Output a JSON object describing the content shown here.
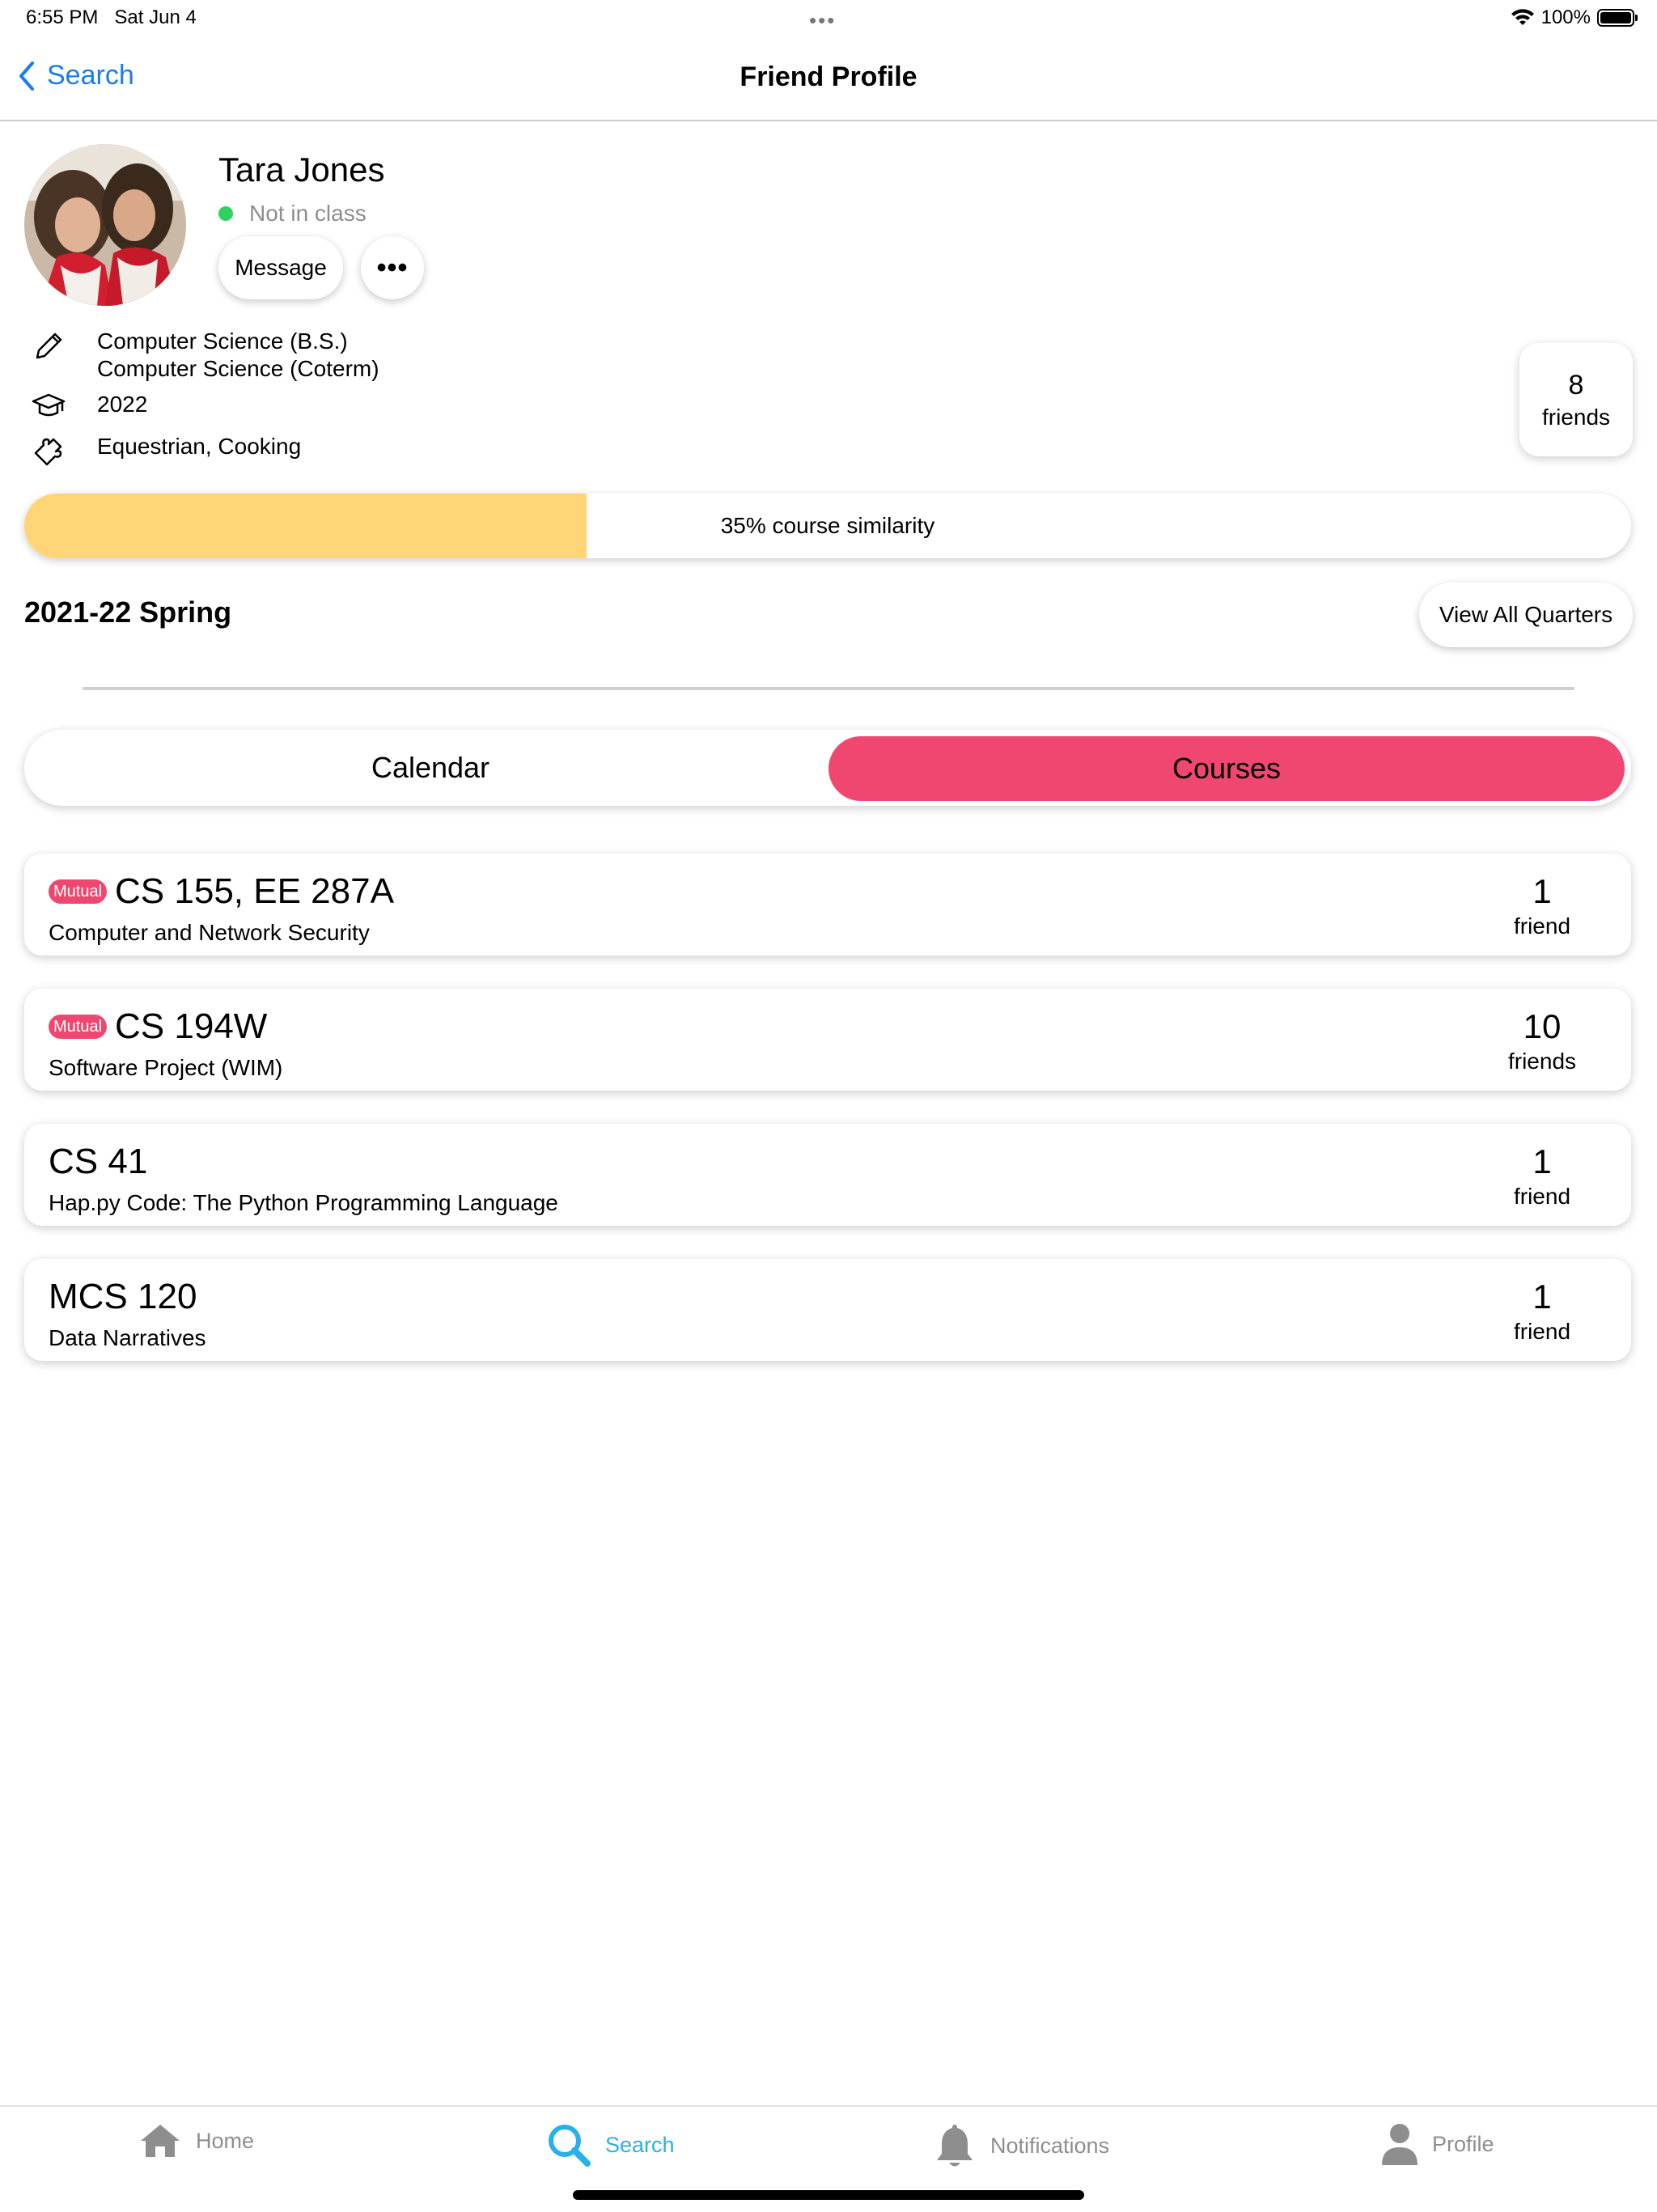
{
  "status_bar": {
    "time": "6:55 PM",
    "date": "Sat Jun 4",
    "dots": "•••",
    "battery": "100%"
  },
  "nav": {
    "back_label": "Search",
    "title": "Friend Profile"
  },
  "profile": {
    "name": "Tara Jones",
    "status": "Not in class",
    "message_label": "Message",
    "more_label": "•••",
    "majors": [
      "Computer Science (B.S.)",
      "Computer Science (Coterm)"
    ],
    "year": "2022",
    "interests": "Equestrian, Cooking",
    "friends_count": "8",
    "friends_label": "friends"
  },
  "similarity": {
    "percent": 35,
    "label": "35% course similarity"
  },
  "quarter": {
    "label": "2021-22 Spring",
    "view_all_label": "View All Quarters"
  },
  "segments": {
    "calendar": "Calendar",
    "courses": "Courses",
    "selected": "courses"
  },
  "courses": [
    {
      "mutual": "Mutual",
      "code": "CS 155, EE 287A",
      "title": "Computer and Network Security",
      "count": "1",
      "count_label": "friend"
    },
    {
      "mutual": "Mutual",
      "code": "CS 194W",
      "title": "Software Project (WIM)",
      "count": "10",
      "count_label": "friends"
    },
    {
      "mutual": "",
      "code": "CS 41",
      "title": "Hap.py Code: The Python Programming Language",
      "count": "1",
      "count_label": "friend"
    },
    {
      "mutual": "",
      "code": "MCS 120",
      "title": "Data Narratives",
      "count": "1",
      "count_label": "friend"
    }
  ],
  "tabs": [
    {
      "label": "Home",
      "icon": "home-icon"
    },
    {
      "label": "Search",
      "icon": "search-icon",
      "active": true
    },
    {
      "label": "Notifications",
      "icon": "bell-icon"
    },
    {
      "label": "Profile",
      "icon": "person-icon"
    }
  ],
  "colors": {
    "accent": "#ef4770",
    "similarity_fill": "#ffd577",
    "link": "#1a7cf0",
    "active_tab": "#2ab0e8",
    "online": "#2fd25f"
  }
}
